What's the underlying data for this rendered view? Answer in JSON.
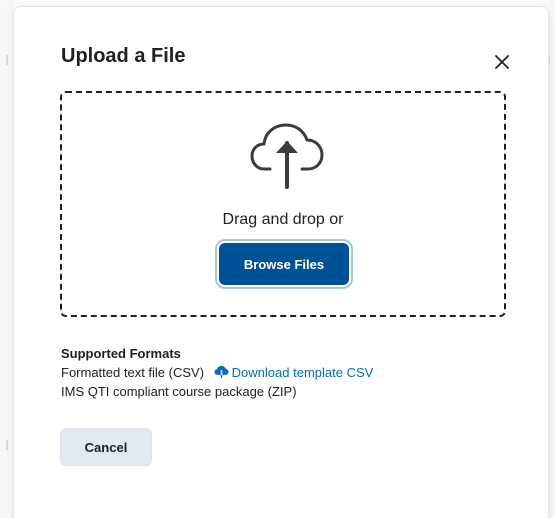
{
  "dialog": {
    "title": "Upload a File",
    "close_icon": "close-icon"
  },
  "dropzone": {
    "icon": "cloud-upload-icon",
    "instruction": "Drag and drop or",
    "browse_label": "Browse Files"
  },
  "formats": {
    "heading": "Supported Formats",
    "csv_label": "Formatted text file (CSV)",
    "download_icon": "cloud-download-icon",
    "download_link": "Download template CSV",
    "zip_label": "IMS QTI compliant course package (ZIP)"
  },
  "footer": {
    "cancel_label": "Cancel"
  },
  "colors": {
    "primary": "#005296",
    "link": "#006fbf",
    "secondary_button": "#e3e9f1",
    "text": "#202122"
  }
}
